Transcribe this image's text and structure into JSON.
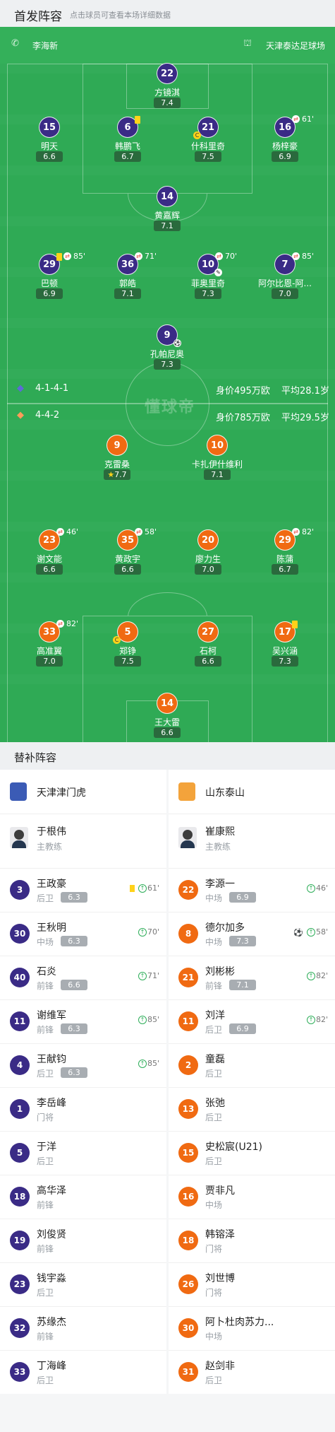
{
  "header": {
    "title": "首发阵容",
    "subtitle": "点击球员可查看本场详细数据"
  },
  "pitch": {
    "referee": "李海新",
    "stadium": "天津泰达足球场",
    "watermark": "懂球帝",
    "home": {
      "formation": "4-1-4-1",
      "value": "身价495万欧",
      "age": "平均28.1岁"
    },
    "away": {
      "formation": "4-4-2",
      "value": "身价785万欧",
      "age": "平均29.5岁"
    }
  },
  "home_players": [
    {
      "num": "22",
      "name": "方镜淇",
      "rating": "7.4"
    },
    {
      "num": "15",
      "name": "明天",
      "rating": "6.6"
    },
    {
      "num": "6",
      "name": "韩鹏飞",
      "rating": "6.7"
    },
    {
      "num": "21",
      "name": "什科里奇",
      "rating": "7.5"
    },
    {
      "num": "16",
      "name": "杨梓豪",
      "rating": "6.9",
      "sub": "61'"
    },
    {
      "num": "14",
      "name": "黄嘉辉",
      "rating": "7.1"
    },
    {
      "num": "29",
      "name": "巴顿",
      "rating": "6.9",
      "sub": "85'"
    },
    {
      "num": "36",
      "name": "郭皓",
      "rating": "7.1",
      "sub": "71'"
    },
    {
      "num": "10",
      "name": "菲奥里奇",
      "rating": "7.3",
      "sub": "70'"
    },
    {
      "num": "7",
      "name": "阿尔比恩-阿...",
      "rating": "7.0",
      "sub": "85'"
    },
    {
      "num": "9",
      "name": "孔帕尼奥",
      "rating": "7.3"
    }
  ],
  "away_players": [
    {
      "num": "9",
      "name": "克雷桑",
      "rating": "7.7"
    },
    {
      "num": "10",
      "name": "卡扎伊什维利",
      "rating": "7.1"
    },
    {
      "num": "23",
      "name": "谢文能",
      "rating": "6.6",
      "sub": "46'"
    },
    {
      "num": "35",
      "name": "黄政宇",
      "rating": "6.6",
      "sub": "58'"
    },
    {
      "num": "20",
      "name": "廖力生",
      "rating": "7.0"
    },
    {
      "num": "29",
      "name": "陈蒲",
      "rating": "6.7",
      "sub": "82'"
    },
    {
      "num": "33",
      "name": "高准翼",
      "rating": "7.0",
      "sub": "82'"
    },
    {
      "num": "5",
      "name": "郑铮",
      "rating": "7.5"
    },
    {
      "num": "27",
      "name": "石柯",
      "rating": "6.6"
    },
    {
      "num": "17",
      "name": "吴兴涵",
      "rating": "7.3"
    },
    {
      "num": "14",
      "name": "王大雷",
      "rating": "6.6"
    }
  ],
  "bench_title": "替补阵容",
  "home_bench": {
    "team": "天津津门虎",
    "coach": {
      "name": "于根伟",
      "role": "主教练"
    },
    "players": [
      {
        "num": "3",
        "name": "王政豪",
        "pos": "后卫",
        "rating": "6.3",
        "event": "61'",
        "yellow": true
      },
      {
        "num": "30",
        "name": "王秋明",
        "pos": "中场",
        "rating": "6.3",
        "event": "70'"
      },
      {
        "num": "40",
        "name": "石炎",
        "pos": "前锋",
        "rating": "6.6",
        "event": "71'"
      },
      {
        "num": "11",
        "name": "谢维军",
        "pos": "前锋",
        "rating": "6.3",
        "event": "85'"
      },
      {
        "num": "4",
        "name": "王献钧",
        "pos": "后卫",
        "rating": "6.3",
        "event": "85'"
      },
      {
        "num": "1",
        "name": "李岳峰",
        "pos": "门将"
      },
      {
        "num": "5",
        "name": "于洋",
        "pos": "后卫"
      },
      {
        "num": "18",
        "name": "高华泽",
        "pos": "前锋"
      },
      {
        "num": "19",
        "name": "刘俊贤",
        "pos": "前锋"
      },
      {
        "num": "23",
        "name": "钱宇淼",
        "pos": "后卫"
      },
      {
        "num": "32",
        "name": "苏缘杰",
        "pos": "前锋"
      },
      {
        "num": "33",
        "name": "丁海峰",
        "pos": "后卫"
      }
    ]
  },
  "away_bench": {
    "team": "山东泰山",
    "coach": {
      "name": "崔康熙",
      "role": "主教练"
    },
    "players": [
      {
        "num": "22",
        "name": "李源一",
        "pos": "中场",
        "rating": "6.9",
        "event": "46'"
      },
      {
        "num": "8",
        "name": "德尔加多",
        "pos": "中场",
        "rating": "7.3",
        "event": "58'",
        "goal": true
      },
      {
        "num": "21",
        "name": "刘彬彬",
        "pos": "前锋",
        "rating": "7.1",
        "event": "82'"
      },
      {
        "num": "11",
        "name": "刘洋",
        "pos": "后卫",
        "rating": "6.9",
        "event": "82'"
      },
      {
        "num": "2",
        "name": "童磊",
        "pos": "后卫"
      },
      {
        "num": "13",
        "name": "张弛",
        "pos": "后卫"
      },
      {
        "num": "15",
        "name": "史松宸(U21)",
        "pos": "后卫"
      },
      {
        "num": "16",
        "name": "贾非凡",
        "pos": "中场"
      },
      {
        "num": "18",
        "name": "韩镕泽",
        "pos": "门将"
      },
      {
        "num": "26",
        "name": "刘世博",
        "pos": "门将"
      },
      {
        "num": "30",
        "name": "阿卜杜肉苏力...",
        "pos": "中场"
      },
      {
        "num": "31",
        "name": "赵剑非",
        "pos": "后卫"
      }
    ]
  },
  "colors": {
    "pitch": "#2faa55",
    "home": "#3a2b86",
    "away": "#f06a12",
    "yellow_card": "#ffd21a",
    "sub_icon": "#e8463c",
    "sub_in": "#2fae5a"
  }
}
